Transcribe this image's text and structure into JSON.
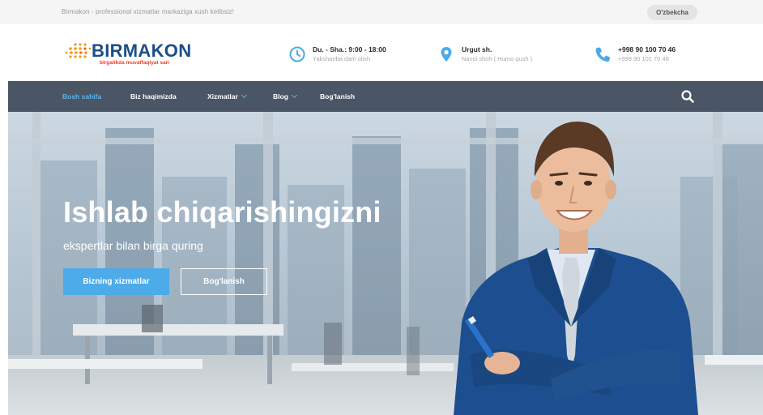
{
  "topbar": {
    "welcome": "Birmakon - professional xizmatlar markaziga xush kelibsiz!",
    "language": "O'zbekcha"
  },
  "brand": {
    "name": "BIRMAKON",
    "tagline": "birgalikda muvaffaqiyat sari",
    "colors": {
      "primary": "#1a4e8a",
      "accent": "#e8412c",
      "dots": "#f39c12"
    }
  },
  "contact": {
    "hours": {
      "icon": "clock-icon",
      "line1": "Du. - Sha.: 9:00 - 18:00",
      "line2": "Yakshanba dam olish"
    },
    "address": {
      "icon": "map-pin-icon",
      "line1": "Urgut sh.",
      "line2": "Navoi shoh ( Humo qush )"
    },
    "phone": {
      "icon": "phone-icon",
      "line1": "+998 90 100 70 46",
      "line2": "+998 90 101 70 46"
    }
  },
  "nav": {
    "items": [
      {
        "label": "Bosh sahifa",
        "active": true,
        "dropdown": false
      },
      {
        "label": "Biz haqimizda",
        "active": false,
        "dropdown": false
      },
      {
        "label": "Xizmatlar",
        "active": false,
        "dropdown": true
      },
      {
        "label": "Blog",
        "active": false,
        "dropdown": true
      },
      {
        "label": "Bog'lanish",
        "active": false,
        "dropdown": false
      }
    ],
    "search_icon": "search-icon",
    "colors": {
      "background": "#4a5565",
      "active": "#5fb2e8"
    }
  },
  "hero": {
    "title": "Ishlab chiqarishingizni",
    "subtitle": "ekspertlar bilan birga quring",
    "primary_button": "Bizning xizmatlar",
    "secondary_button": "Bog'lanish",
    "colors": {
      "button": "#4cabe8"
    }
  }
}
